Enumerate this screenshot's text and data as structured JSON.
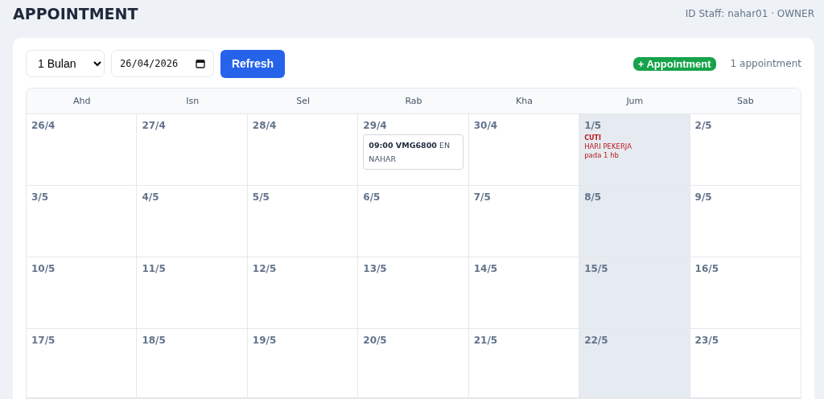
{
  "header": {
    "title": "APPOINTMENT",
    "staff": "ID Staff: nahar01 · OWNER"
  },
  "toolbar": {
    "range": "1 Bulan",
    "date": "26/04/2026",
    "refresh": "Refresh",
    "add": "+ Appointment",
    "count": "1 appointment"
  },
  "calendar": {
    "weekdays": [
      "Ahd",
      "Isn",
      "Sel",
      "Rab",
      "Kha",
      "Jum",
      "Sab"
    ],
    "weeks": [
      [
        {
          "date": "26/4",
          "shaded": false
        },
        {
          "date": "27/4",
          "shaded": false
        },
        {
          "date": "28/4",
          "shaded": false
        },
        {
          "date": "29/4",
          "shaded": false,
          "events": [
            {
              "kind": "appointment",
              "text": "**09:00 VMG6800** EN NAHAR"
            }
          ]
        },
        {
          "date": "30/4",
          "shaded": false
        },
        {
          "date": "1/5",
          "shaded": true,
          "events": [
            {
              "kind": "leave",
              "title": "CUTI",
              "lines": [
                "HARI PEKERJA",
                "pada 1 hb"
              ]
            }
          ]
        },
        {
          "date": "2/5",
          "shaded": false
        }
      ],
      [
        {
          "date": "3/5",
          "shaded": false
        },
        {
          "date": "4/5",
          "shaded": false
        },
        {
          "date": "5/5",
          "shaded": false
        },
        {
          "date": "6/5",
          "shaded": false
        },
        {
          "date": "7/5",
          "shaded": false
        },
        {
          "date": "8/5",
          "shaded": true
        },
        {
          "date": "9/5",
          "shaded": false
        }
      ],
      [
        {
          "date": "10/5",
          "shaded": false
        },
        {
          "date": "11/5",
          "shaded": false
        },
        {
          "date": "12/5",
          "shaded": false
        },
        {
          "date": "13/5",
          "shaded": false
        },
        {
          "date": "14/5",
          "shaded": false
        },
        {
          "date": "15/5",
          "shaded": true
        },
        {
          "date": "16/5",
          "shaded": false
        }
      ],
      [
        {
          "date": "17/5",
          "shaded": false
        },
        {
          "date": "18/5",
          "shaded": false
        },
        {
          "date": "19/5",
          "shaded": false
        },
        {
          "date": "20/5",
          "shaded": false
        },
        {
          "date": "21/5",
          "shaded": false
        },
        {
          "date": "22/5",
          "shaded": true
        },
        {
          "date": "23/5",
          "shaded": false
        }
      ]
    ]
  }
}
